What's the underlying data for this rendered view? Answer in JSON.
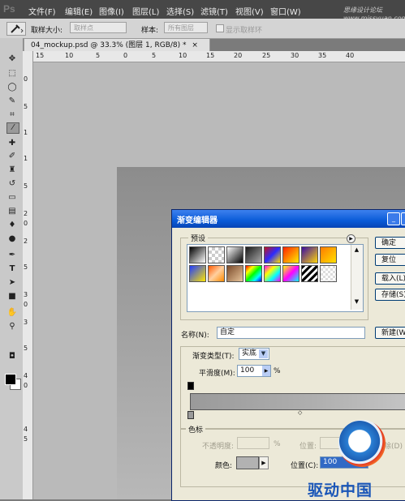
{
  "app": {
    "logo": "Ps"
  },
  "menubar": {
    "items": [
      "文件(F)",
      "编辑(E)",
      "图像(I)",
      "图层(L)",
      "选择(S)",
      "滤镜(T)",
      "视图(V)",
      "窗口(W)"
    ],
    "watermark": "思缘设计论坛 www.missyuan.com"
  },
  "options_bar": {
    "tool_icon": "eyedropper-icon",
    "sample_size_label": "取样大小:",
    "sample_size_value": "取样点",
    "sample_label": "样本:",
    "sample_value": "所有图层",
    "show_ring_label": "显示取样环"
  },
  "document": {
    "tab_title": "04_mockup.psd @ 33.3% (图层 1, RGB/8) *",
    "close_glyph": "×"
  },
  "rulers": {
    "top": [
      "15",
      "10",
      "5",
      "0",
      "5",
      "10",
      "15",
      "20",
      "25",
      "30",
      "35",
      "40"
    ],
    "left": [
      "0",
      "5",
      "1",
      "1",
      "5",
      "2",
      "0",
      "2",
      "5",
      "3",
      "0",
      "3",
      "5",
      "4",
      "0",
      "4",
      "5"
    ]
  },
  "toolbox": {
    "tools": [
      "move-icon",
      "marquee-icon",
      "lasso-icon",
      "quick-select-icon",
      "crop-icon",
      "eyedropper-icon",
      "healing-icon",
      "brush-icon",
      "stamp-icon",
      "history-brush-icon",
      "eraser-icon",
      "gradient-icon",
      "blur-icon",
      "dodge-icon",
      "pen-icon",
      "type-icon",
      "path-select-icon",
      "shape-icon",
      "hand-icon",
      "zoom-icon"
    ],
    "active_tool": "eyedropper-icon"
  },
  "gradient_editor": {
    "title": "渐变编辑器",
    "presets_label": "预设",
    "buttons": {
      "ok": "确定",
      "reset": "复位",
      "load": "载入(L)...",
      "save": "存储(S)...",
      "new": "新建(W)"
    },
    "name_label": "名称(N):",
    "name_value": "自定",
    "type_label": "渐变类型(T):",
    "type_value": "实底",
    "smoothness_label": "平滑度(M):",
    "smoothness_value": "100",
    "smoothness_unit": "%",
    "stops_group": "色标",
    "opacity_label": "不透明度:",
    "opacity_unit": "%",
    "location_label": "位置:",
    "delete_label": "删除(D)",
    "color_label": "颜色:",
    "color_location_label": "位置(C):",
    "color_location_value": "100",
    "stop_color": "#b2b2b2",
    "preset_swatches": [
      [
        "linear-gradient(135deg,#000,#fff)",
        "repeating-conic-gradient(#ccc 0% 25%, #fff 0% 50%) 0 0/8px 8px",
        "linear-gradient(135deg,#fff,#000)",
        "linear-gradient(135deg,#1a1a1a,#aaa)",
        "linear-gradient(135deg,#c1121f,#2b2bff,#ffde00)",
        "linear-gradient(135deg,#ff2200,#ffee00)",
        "linear-gradient(135deg,#3a0ca3,#ffd60a)",
        "linear-gradient(135deg,#ff7b00,#ffe000)"
      ],
      [
        "linear-gradient(135deg,#203cff,#ffe600)",
        "linear-gradient(135deg,#ff5a00,#ffd0a0,#ff8a00)",
        "linear-gradient(135deg,#7a4a2a,#e7c49a)",
        "linear-gradient(135deg,#ff0000,#ffff00,#00ff00,#00ffff,#0000ff)",
        "linear-gradient(135deg,#ff00ff,#ffff00,#00ffff,#ff00ff)",
        "linear-gradient(135deg,#ff0,#f0f,#0ff)",
        "repeating-linear-gradient(135deg,#000 0 3px,#fff 3px 6px)",
        "repeating-conic-gradient(#ddd 0% 25%, #fff 0% 50%) 0 0/6px 6px"
      ]
    ]
  },
  "logo": {
    "text": "驱动中国"
  }
}
